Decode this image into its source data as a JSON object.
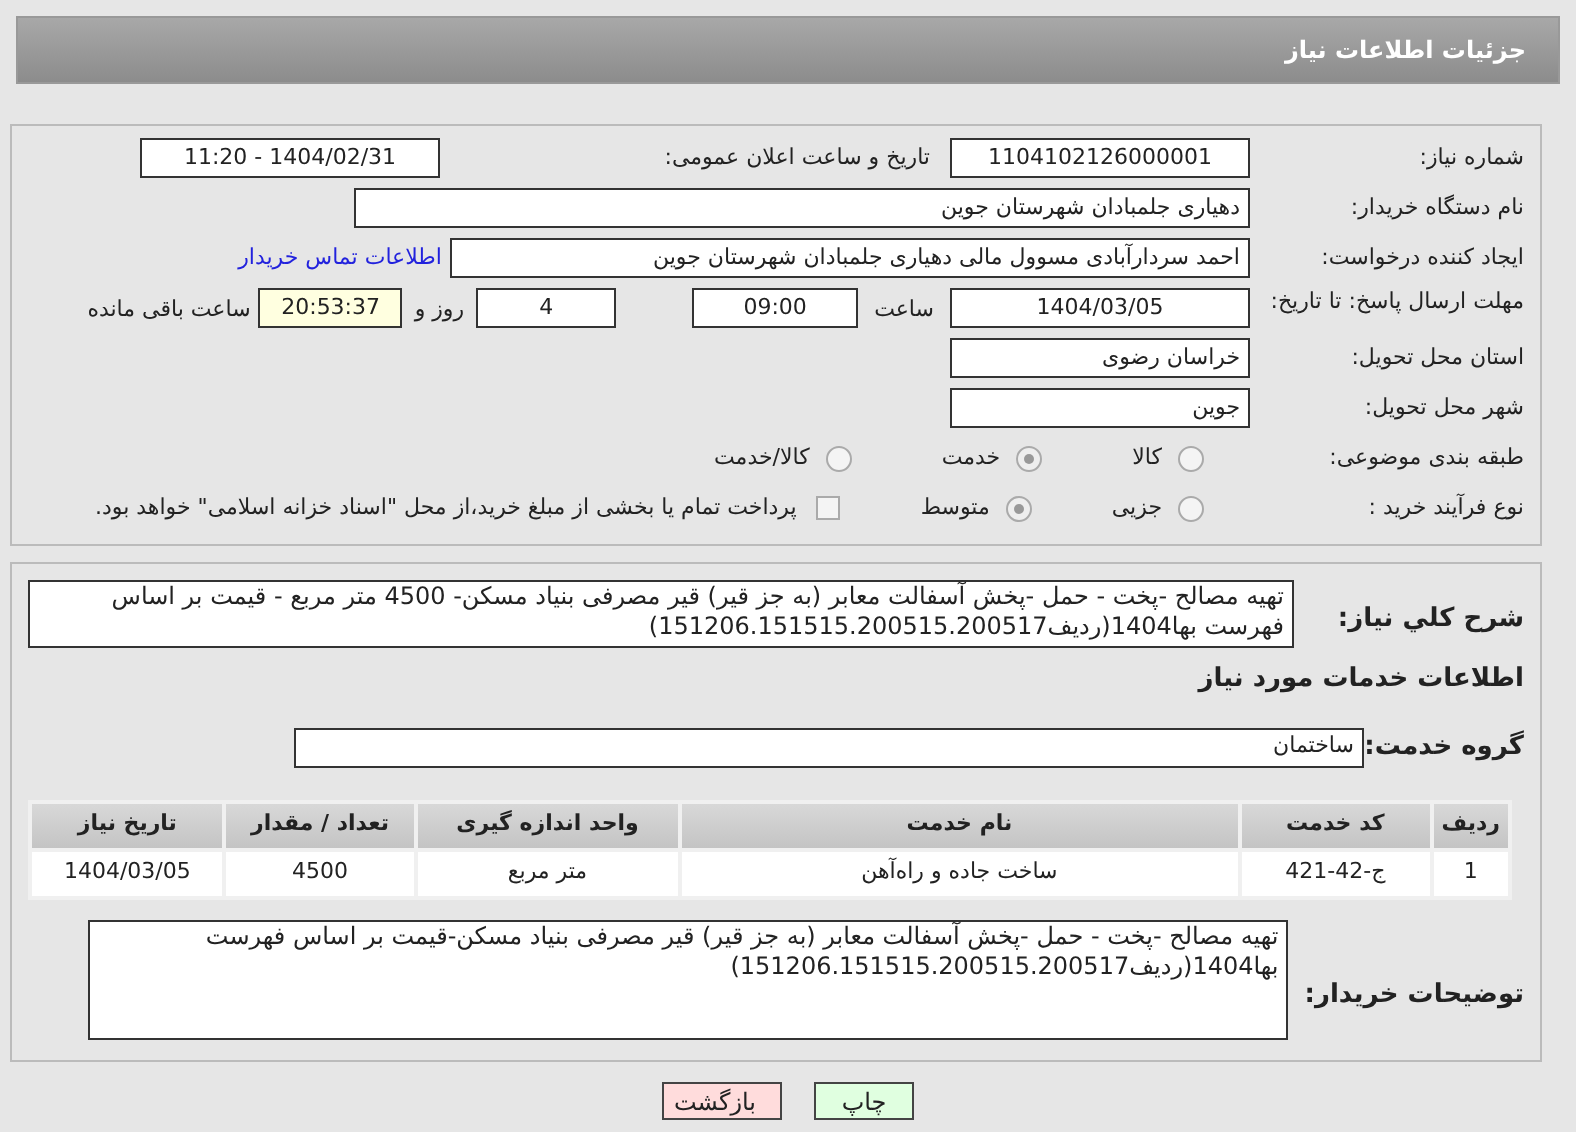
{
  "header": {
    "title": "جزئیات اطلاعات نیاز"
  },
  "need_number": {
    "label": "شماره نیاز:",
    "value": "1104102126000001"
  },
  "announce": {
    "label": "تاریخ و ساعت اعلان عمومی:",
    "value": "1404/02/31 - 11:20"
  },
  "buyer_org": {
    "label": "نام دستگاه خریدار:",
    "value": "دهیاری جلمبادان  شهرستان جوین"
  },
  "requester": {
    "label": "ایجاد کننده درخواست:",
    "value": "احمد سردارآبادی مسوول مالی دهیاری جلمبادان  شهرستان جوین",
    "link": "اطلاعات تماس خریدار"
  },
  "deadline": {
    "label": "مهلت ارسال پاسخ: تا تاریخ:",
    "date": "1404/03/05",
    "time_label": "ساعت",
    "time": "09:00",
    "days": "4",
    "days_label": "روز و",
    "remaining": "20:53:37",
    "remaining_label": "ساعت باقی مانده"
  },
  "province": {
    "label": "استان محل تحویل:",
    "value": "خراسان رضوی"
  },
  "city": {
    "label": "شهر محل تحویل:",
    "value": "جوین"
  },
  "category": {
    "label": "طبقه بندی موضوعی:",
    "options": [
      {
        "label": "کالا",
        "selected": false
      },
      {
        "label": "خدمت",
        "selected": true
      },
      {
        "label": "کالا/خدمت",
        "selected": false
      }
    ]
  },
  "purchase_type": {
    "label": "نوع فرآیند خرید :",
    "options": [
      {
        "label": "جزیی",
        "selected": false
      },
      {
        "label": "متوسط",
        "selected": true
      }
    ],
    "treasury": {
      "checked": false,
      "label": "پرداخت تمام یا بخشی از مبلغ خرید،از محل \"اسناد خزانه اسلامی\" خواهد بود."
    }
  },
  "summary": {
    "label": "شرح کلي نياز:",
    "value": "تهیه مصالح -پخت - حمل -پخش آسفالت معابر (به جز قیر) قیر مصرفی بنیاد مسکن- 4500 متر مربع - قیمت بر اساس فهرست بها1404(ردیف151206.151515.200515.200517)"
  },
  "services_title": "اطلاعات خدمات مورد نیاز",
  "service_group": {
    "label": "گروه خدمت:",
    "value": "ساختمان"
  },
  "table": {
    "columns": [
      "ردیف",
      "کد خدمت",
      "نام خدمت",
      "واحد اندازه گیری",
      "تعداد / مقدار",
      "تاریخ نیاز"
    ],
    "rows": [
      [
        "1",
        "ج-42-421",
        "ساخت جاده و راه‌آهن",
        "متر مربع",
        "4500",
        "1404/03/05"
      ]
    ]
  },
  "buyer_notes": {
    "label": "توضیحات خریدار:",
    "value": "تهیه مصالح -پخت - حمل -پخش آسفالت معابر (به جز قیر) قیر مصرفی بنیاد مسکن-قیمت بر اساس فهرست بها1404(ردیف151206.151515.200515.200517)"
  },
  "buttons": [
    {
      "label": "چاپ",
      "kind": "print"
    },
    {
      "label": "بازگشت",
      "kind": "back"
    }
  ]
}
